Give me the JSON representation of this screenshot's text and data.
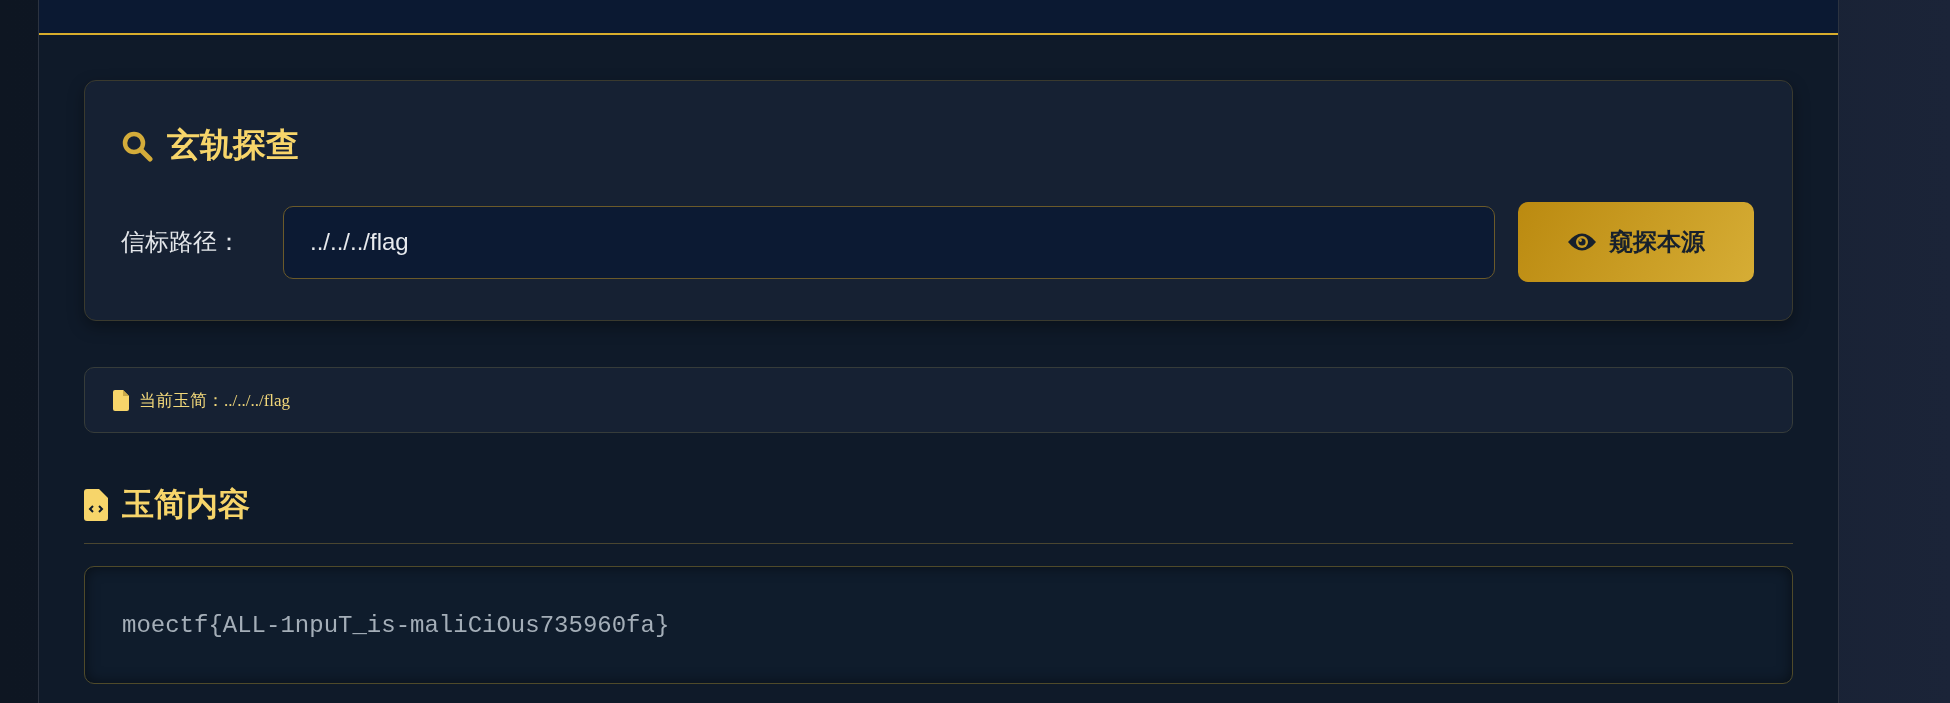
{
  "search_card": {
    "title": "玄轨探查",
    "field_label": "信标路径：",
    "path_field": {
      "value": "../../../flag"
    },
    "button": "窥探本源"
  },
  "current_file": {
    "label": "当前玉简：",
    "path": "../../../flag"
  },
  "content_section": {
    "title": "玉简内容",
    "code": "moectf{ALL-1npuT_is-maliCiOus735960fa}"
  }
}
